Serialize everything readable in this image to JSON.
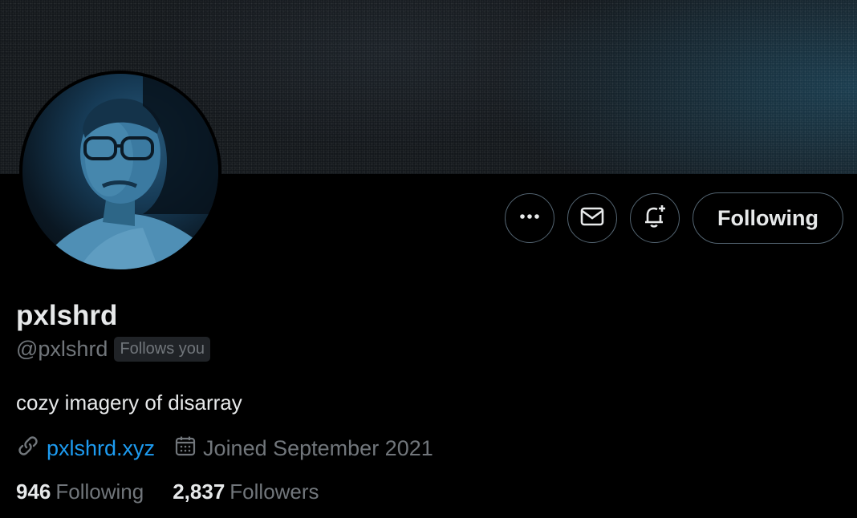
{
  "profile": {
    "display_name": "pxlshrd",
    "handle": "@pxlshrd",
    "follows_you_badge": "Follows you",
    "bio": "cozy imagery of disarray",
    "website": "pxlshrd.xyz",
    "joined": "Joined September 2021"
  },
  "stats": {
    "following_count": "946",
    "following_label": "Following",
    "followers_count": "2,837",
    "followers_label": "Followers"
  },
  "actions": {
    "more_icon": "more-horizontal-icon",
    "message_icon": "envelope-icon",
    "notify_icon": "bell-plus-icon",
    "following_button_label": "Following"
  },
  "colors": {
    "background": "#000000",
    "primary_text": "#e7e9ea",
    "secondary_text": "#71767b",
    "link": "#1d9bf0",
    "border": "#536471"
  }
}
